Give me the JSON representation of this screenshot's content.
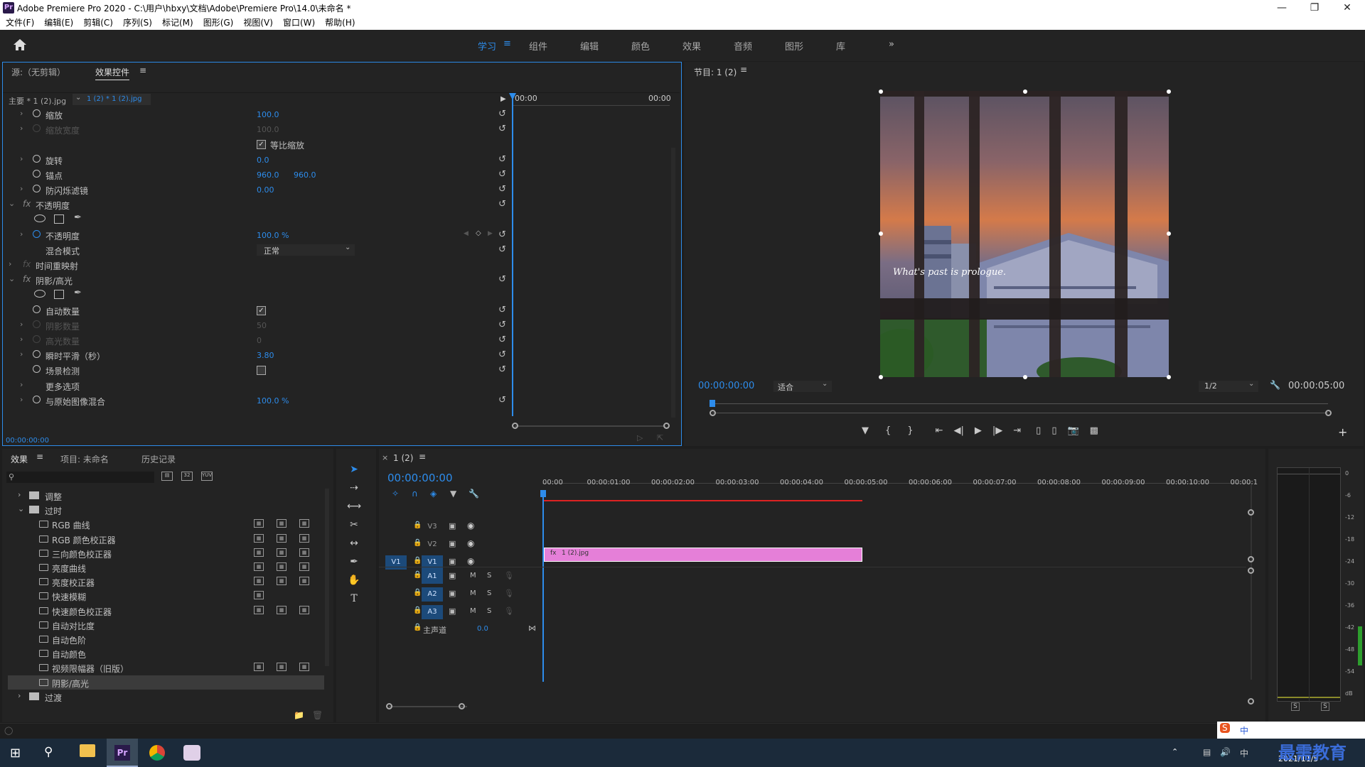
{
  "window": {
    "title": "Adobe Premiere Pro 2020 - C:\\用户\\hbxy\\文档\\Adobe\\Premiere Pro\\14.0\\未命名 *",
    "app_icon": "Pr"
  },
  "menu": [
    "文件(F)",
    "编辑(E)",
    "剪辑(C)",
    "序列(S)",
    "标记(M)",
    "图形(G)",
    "视图(V)",
    "窗口(W)",
    "帮助(H)"
  ],
  "workspaces": [
    "学习",
    "组件",
    "编辑",
    "颜色",
    "效果",
    "音频",
    "图形",
    "库"
  ],
  "active_workspace": "学习",
  "source_panel": {
    "tabs": [
      "源:（无剪辑）",
      "效果控件"
    ],
    "active_tab": "效果控件",
    "master_clip": "主要 * 1 (2).jpg",
    "clip_select": "1 (2) * 1 (2).jpg",
    "time_start": "00:00",
    "time_end": "00:00",
    "bottom_time": "00:00:00:00",
    "properties": [
      {
        "label": "缩放",
        "value": "100.0",
        "arrow": true,
        "sw": true,
        "dim": false
      },
      {
        "label": "缩放宽度",
        "value": "100.0",
        "arrow": true,
        "sw": true,
        "dim": true
      },
      {
        "label": "等比缩放",
        "checkbox": true,
        "checked": true
      },
      {
        "label": "旋转",
        "value": "0.0",
        "arrow": true,
        "sw": true
      },
      {
        "label": "锚点",
        "value": "960.0",
        "value2": "960.0",
        "sw": true
      },
      {
        "label": "防闪烁滤镜",
        "value": "0.00",
        "arrow": true,
        "sw": true
      },
      {
        "section": "不透明度",
        "fx": true
      },
      {
        "masks": true
      },
      {
        "label": "不透明度",
        "value": "100.0 %",
        "arrow": true,
        "sw": true,
        "blue_sw": true,
        "keyframe": true
      },
      {
        "label": "混合模式",
        "select": "正常"
      },
      {
        "section": "时间重映射",
        "fx": true,
        "dim_fx": true,
        "no_reset": true
      },
      {
        "section": "阴影/高光",
        "fx": true
      },
      {
        "masks": true
      },
      {
        "label": "自动数量",
        "checkbox": true,
        "checked": true,
        "sw": true
      },
      {
        "label": "阴影数量",
        "value": "50",
        "arrow": true,
        "sw": true,
        "dim": true
      },
      {
        "label": "高光数量",
        "value": "0",
        "arrow": true,
        "sw": true,
        "dim": true
      },
      {
        "label": "瞬时平滑（秒）",
        "value": "3.80",
        "arrow": true,
        "sw": true
      },
      {
        "label": "场景检测",
        "checkbox": true,
        "checked": false,
        "sw": true
      },
      {
        "label": "更多选项",
        "arrow": true,
        "no_reset": true
      },
      {
        "label": "与原始图像混合",
        "value": "100.0 %",
        "arrow": true,
        "sw": true
      }
    ]
  },
  "program": {
    "title": "节目: 1 (2)",
    "timecode": "00:00:00:00",
    "fit": "适合",
    "quality": "1/2",
    "duration": "00:00:05:00",
    "caption": "What's past is prologue."
  },
  "effects_panel": {
    "tabs": [
      "效果",
      "项目: 未命名",
      "历史记录"
    ],
    "active_tab": "效果",
    "tree": [
      {
        "label": "调整",
        "level": 0,
        "folder": true,
        "open": false
      },
      {
        "label": "过时",
        "level": 0,
        "folder": true,
        "open": true
      },
      {
        "label": "RGB 曲线",
        "level": 1,
        "badges": 3
      },
      {
        "label": "RGB 颜色校正器",
        "level": 1,
        "badges": 3
      },
      {
        "label": "三向颜色校正器",
        "level": 1,
        "badges": 3
      },
      {
        "label": "亮度曲线",
        "level": 1,
        "badges": 3
      },
      {
        "label": "亮度校正器",
        "level": 1,
        "badges": 3
      },
      {
        "label": "快速模糊",
        "level": 1,
        "badges": 1
      },
      {
        "label": "快速颜色校正器",
        "level": 1,
        "badges": 3
      },
      {
        "label": "自动对比度",
        "level": 1,
        "badges": 0
      },
      {
        "label": "自动色阶",
        "level": 1,
        "badges": 0
      },
      {
        "label": "自动颜色",
        "level": 1,
        "badges": 0
      },
      {
        "label": "视频限幅器（旧版）",
        "level": 1,
        "badges": 3
      },
      {
        "label": "阴影/高光",
        "level": 1,
        "badges": 0,
        "selected": true
      },
      {
        "label": "过渡",
        "level": 0,
        "folder": true,
        "open": false
      }
    ]
  },
  "timeline": {
    "tab": "1 (2)",
    "timecode": "00:00:00:00",
    "ruler": [
      "00:00",
      "00:00:01:00",
      "00:00:02:00",
      "00:00:03:00",
      "00:00:04:00",
      "00:00:05:00",
      "00:00:06:00",
      "00:00:07:00",
      "00:00:08:00",
      "00:00:09:00",
      "00:00:10:00",
      "00:00:1"
    ],
    "video_tracks": [
      "V3",
      "V2",
      "V1"
    ],
    "audio_tracks": [
      "A1",
      "A2",
      "A3"
    ],
    "source_patch": "V1",
    "master": {
      "label": "主声道",
      "value": "0.0"
    },
    "clip": {
      "name": "1 (2).jpg",
      "badge": "fx",
      "color": "#e57fd8"
    }
  },
  "audio_meter": {
    "scale": [
      "0",
      "-6",
      "-12",
      "-18",
      "-24",
      "-30",
      "-36",
      "-42",
      "-48",
      "-54",
      "dB"
    ],
    "solo": [
      "S",
      "S"
    ]
  },
  "tray": {
    "time": "",
    "date": "2021/11/5",
    "watermark": "最需教育",
    "ime": "中"
  }
}
